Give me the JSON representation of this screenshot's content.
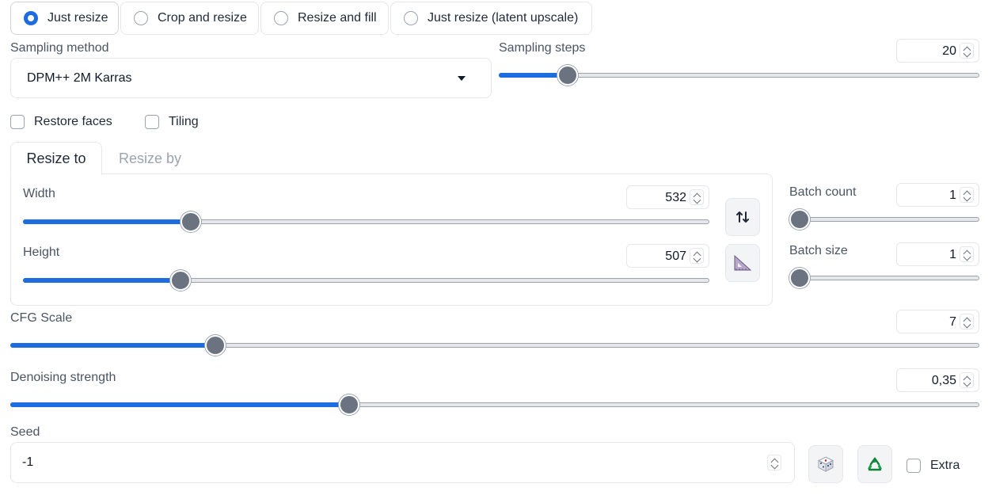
{
  "resize_mode": {
    "options": [
      "Just resize",
      "Crop and resize",
      "Resize and fill",
      "Just resize (latent upscale)"
    ],
    "selected": "Just resize"
  },
  "sampling_method": {
    "label": "Sampling method",
    "value": "DPM++ 2M Karras"
  },
  "sampling_steps": {
    "label": "Sampling steps",
    "value": "20",
    "fill_fraction": 0.144
  },
  "restore_faces": {
    "label": "Restore faces",
    "checked": false
  },
  "tiling": {
    "label": "Tiling",
    "checked": false
  },
  "tabs": {
    "resize_to": "Resize to",
    "resize_by": "Resize by",
    "active": "Resize to"
  },
  "width": {
    "label": "Width",
    "value": "532",
    "fill_fraction": 0.244
  },
  "height": {
    "label": "Height",
    "value": "507",
    "fill_fraction": 0.229
  },
  "batch_count": {
    "label": "Batch count",
    "value": "1",
    "fill_fraction": 0.0
  },
  "batch_size": {
    "label": "Batch size",
    "value": "1",
    "fill_fraction": 0.0
  },
  "cfg_scale": {
    "label": "CFG Scale",
    "value": "7",
    "fill_fraction": 0.212
  },
  "denoising_strength": {
    "label": "Denoising strength",
    "value": "0,35",
    "fill_fraction": 0.35
  },
  "seed": {
    "label": "Seed",
    "value": "-1"
  },
  "extra": {
    "label": "Extra",
    "checked": false
  },
  "icons": {
    "swap": "swap-dimensions-icon",
    "ratio": "triangle-ruler-icon",
    "random": "dice-icon",
    "reuse": "recycle-icon"
  },
  "colors": {
    "accent": "#1d6ce0",
    "thumb": "#6b7280"
  }
}
